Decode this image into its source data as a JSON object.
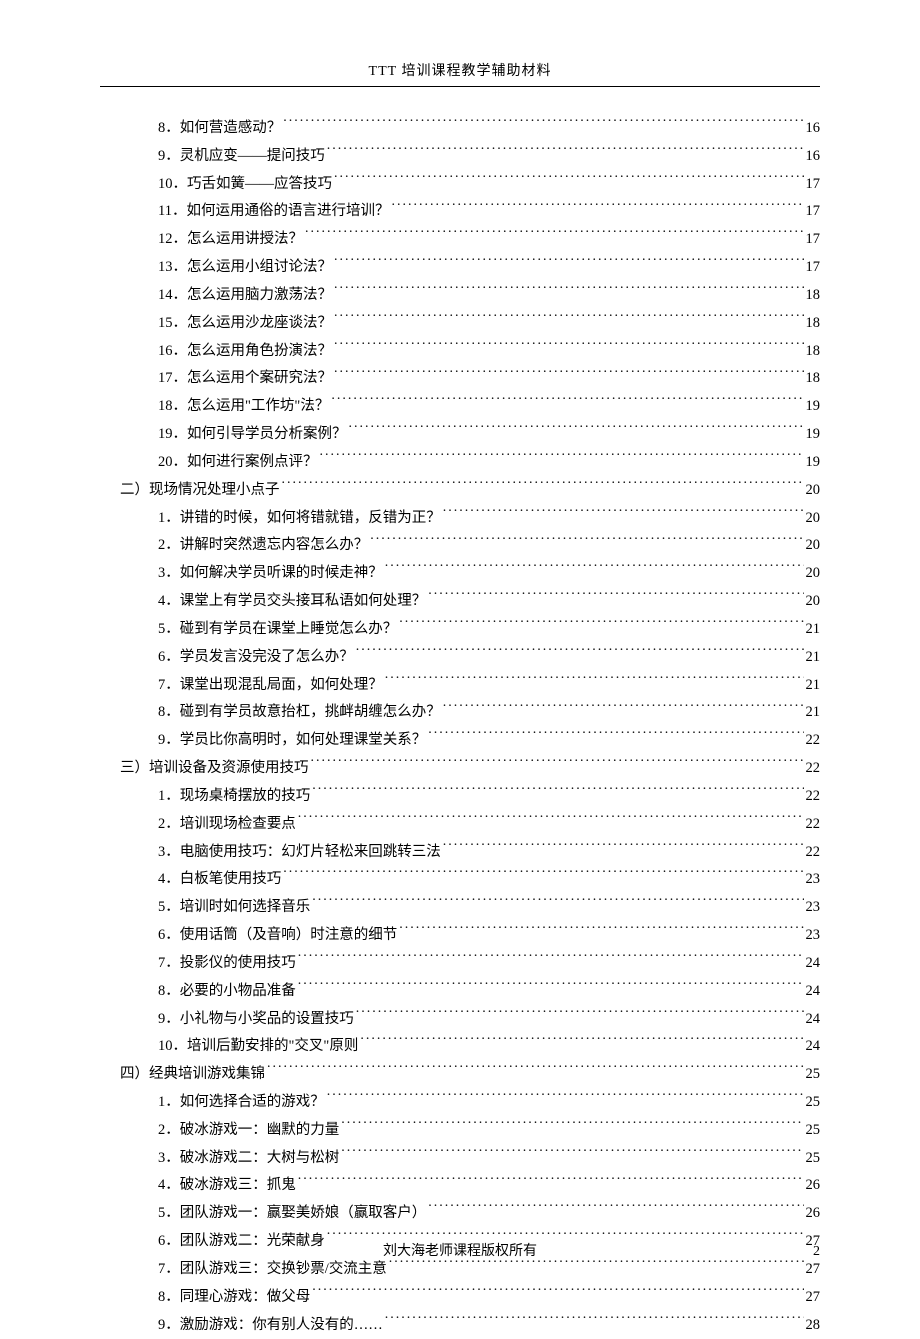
{
  "header": "TTT 培训课程教学辅助材料",
  "footer": "刘大海老师课程版权所有",
  "page_number": "2",
  "toc": [
    {
      "level": "item",
      "label": "8．如何营造感动？",
      "page": "16"
    },
    {
      "level": "item",
      "label": "9．灵机应变——提问技巧",
      "page": "16"
    },
    {
      "level": "item",
      "label": "10．巧舌如簧——应答技巧",
      "page": "17"
    },
    {
      "level": "item",
      "label": "11．如何运用通俗的语言进行培训？",
      "page": "17"
    },
    {
      "level": "item",
      "label": "12．怎么运用讲授法？",
      "page": "17"
    },
    {
      "level": "item",
      "label": "13．怎么运用小组讨论法？",
      "page": "17"
    },
    {
      "level": "item",
      "label": "14．怎么运用脑力激荡法？",
      "page": "18"
    },
    {
      "level": "item",
      "label": "15．怎么运用沙龙座谈法？",
      "page": "18"
    },
    {
      "level": "item",
      "label": "16．怎么运用角色扮演法？",
      "page": "18"
    },
    {
      "level": "item",
      "label": "17．怎么运用个案研究法？",
      "page": "18"
    },
    {
      "level": "item",
      "label": "18．怎么运用\"工作坊\"法？",
      "page": "19"
    },
    {
      "level": "item",
      "label": "19．如何引导学员分析案例？",
      "page": "19"
    },
    {
      "level": "item",
      "label": "20．如何进行案例点评？",
      "page": "19"
    },
    {
      "level": "section",
      "label": "二）现场情况处理小点子",
      "page": "20"
    },
    {
      "level": "item",
      "label": "1．讲错的时候，如何将错就错，反错为正？",
      "page": "20"
    },
    {
      "level": "item",
      "label": "2．讲解时突然遗忘内容怎么办？",
      "page": "20"
    },
    {
      "level": "item",
      "label": "3．如何解决学员听课的时候走神？",
      "page": "20"
    },
    {
      "level": "item",
      "label": "4．课堂上有学员交头接耳私语如何处理？",
      "page": "20"
    },
    {
      "level": "item",
      "label": "5．碰到有学员在课堂上睡觉怎么办？",
      "page": "21"
    },
    {
      "level": "item",
      "label": "6．学员发言没完没了怎么办？",
      "page": "21"
    },
    {
      "level": "item",
      "label": "7．课堂出现混乱局面，如何处理？",
      "page": "21"
    },
    {
      "level": "item",
      "label": "8．碰到有学员故意抬杠，挑衅胡缠怎么办？",
      "page": "21"
    },
    {
      "level": "item",
      "label": "9．学员比你高明时，如何处理课堂关系？",
      "page": "22"
    },
    {
      "level": "section",
      "label": "三）培训设备及资源使用技巧",
      "page": "22"
    },
    {
      "level": "item",
      "label": "1．现场桌椅摆放的技巧",
      "page": "22"
    },
    {
      "level": "item",
      "label": "2．培训现场检查要点",
      "page": "22"
    },
    {
      "level": "item",
      "label": "3．电脑使用技巧：幻灯片轻松来回跳转三法",
      "page": "22"
    },
    {
      "level": "item",
      "label": "4．白板笔使用技巧",
      "page": "23"
    },
    {
      "level": "item",
      "label": "5．培训时如何选择音乐",
      "page": "23"
    },
    {
      "level": "item",
      "label": "6．使用话筒（及音响）时注意的细节",
      "page": "23"
    },
    {
      "level": "item",
      "label": "7．投影仪的使用技巧",
      "page": "24"
    },
    {
      "level": "item",
      "label": "8．必要的小物品准备",
      "page": "24"
    },
    {
      "level": "item",
      "label": "9．小礼物与小奖品的设置技巧",
      "page": "24"
    },
    {
      "level": "item",
      "label": "10．培训后勤安排的\"交叉\"原则",
      "page": "24"
    },
    {
      "level": "section",
      "label": "四）经典培训游戏集锦",
      "page": "25"
    },
    {
      "level": "item",
      "label": "1．如何选择合适的游戏？",
      "page": "25"
    },
    {
      "level": "item",
      "label": "2．破冰游戏一：幽默的力量",
      "page": "25"
    },
    {
      "level": "item",
      "label": "3．破冰游戏二：大树与松树",
      "page": "25"
    },
    {
      "level": "item",
      "label": "4．破冰游戏三：抓鬼",
      "page": "26"
    },
    {
      "level": "item",
      "label": "5．团队游戏一：赢娶美娇娘（赢取客户）",
      "page": "26"
    },
    {
      "level": "item",
      "label": "6．团队游戏二：光荣献身",
      "page": "27"
    },
    {
      "level": "item",
      "label": "7．团队游戏三：交换钞票/交流主意",
      "page": "27"
    },
    {
      "level": "item",
      "label": "8．同理心游戏：做父母",
      "page": "27"
    },
    {
      "level": "item",
      "label": "9．激励游戏：你有别人没有的……",
      "page": "28"
    }
  ]
}
